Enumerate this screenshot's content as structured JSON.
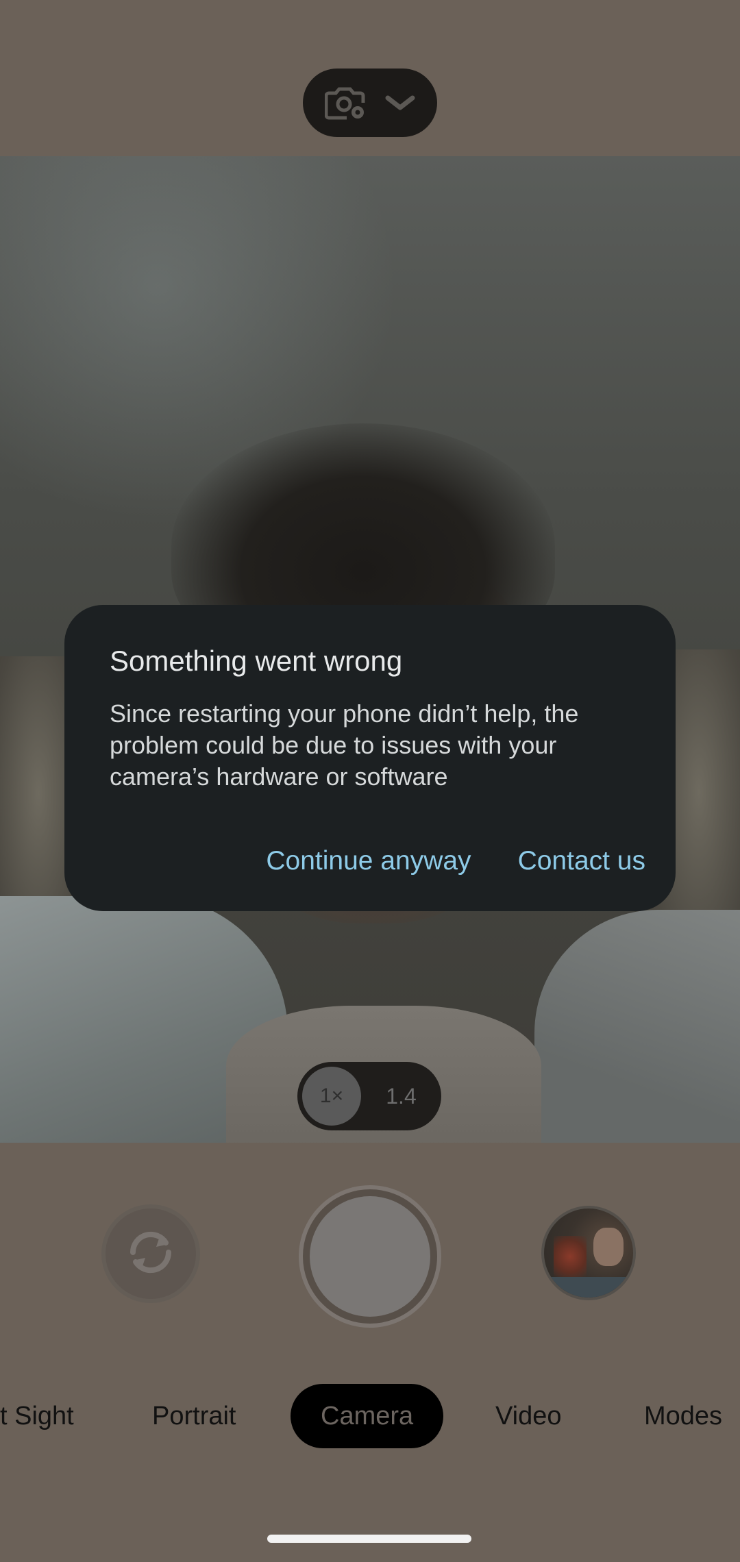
{
  "top_bar": {
    "settings_icon": "camera-settings-icon",
    "chevron_icon": "chevron-down-icon"
  },
  "zoom": {
    "options": [
      "1×",
      "1.4"
    ],
    "selected": "1×"
  },
  "controls": {
    "switch_camera_icon": "switch-camera-icon",
    "shutter": "shutter-button",
    "gallery": "gallery-thumbnail"
  },
  "modes": {
    "items": [
      "t Sight",
      "Portrait",
      "Camera",
      "Video",
      "Modes"
    ],
    "active": "Camera"
  },
  "dialog": {
    "title": "Something went wrong",
    "body": "Since restarting your phone didn’t help, the problem could be due to issues with your camera’s hardware or software",
    "continue_label": "Continue anyway",
    "contact_label": "Contact us"
  },
  "colors": {
    "accent": "#8ecbe8",
    "dialog_bg": "#1c2022",
    "app_bg": "#6b6158"
  }
}
